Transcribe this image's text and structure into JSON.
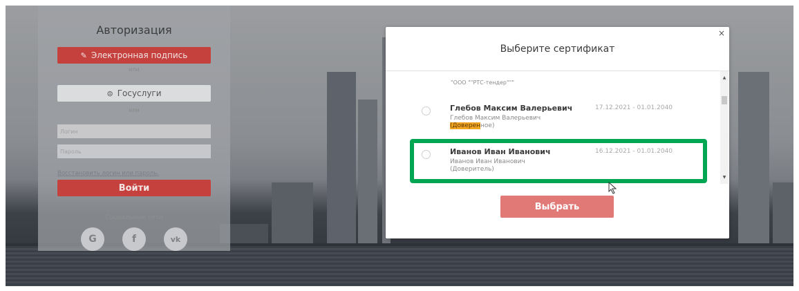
{
  "login": {
    "title": "Авторизация",
    "esign_label": "Электронная подпись",
    "or1": "или",
    "gosuslugi_label": "Госуслуги",
    "or2": "или",
    "login_placeholder": "Логин",
    "password_placeholder": "Пароль",
    "restore_link": "Восстановить логин или пароль.",
    "submit_label": "Войти",
    "social_label": "Социальные сети",
    "social": [
      {
        "label": "G",
        "icon": "google-icon"
      },
      {
        "label": "f",
        "icon": "facebook-icon"
      },
      {
        "label": "vk",
        "icon": "vk-icon"
      }
    ]
  },
  "modal": {
    "title": "Выберите сертификат",
    "close": "×",
    "org": "\"ООО \"\"РТС-тендер\"\"\"",
    "certs": [
      {
        "name": "Глебов Максим Валерьевич",
        "sub1": "Глебов Максим Валерьевич",
        "sub2_hl": "(Доверен",
        "sub2_rest": "ное)",
        "dates": "17.12.2021 - 01.01.2040"
      },
      {
        "name": "Иванов Иван Иванович",
        "sub1": "Иванов Иван Иванович",
        "sub2": "(Доверитель)",
        "dates": "16.12.2021 - 01.01.2040"
      }
    ],
    "select_label": "Выбрать"
  },
  "colors": {
    "accent_red": "#c4413e",
    "select_button": "#e17a77",
    "highlight": "#00a651",
    "search_highlight": "#f5a623"
  }
}
